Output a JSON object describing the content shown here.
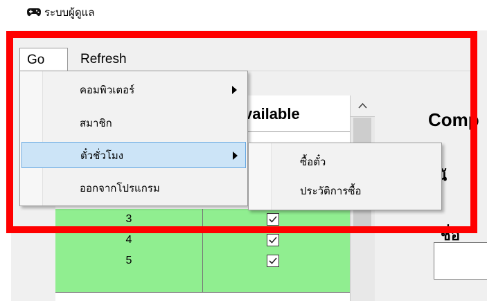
{
  "window": {
    "title": "ระบบผู้ดูแล",
    "icon": "gamepad-icon"
  },
  "menubar": {
    "items": [
      {
        "label": "Go"
      },
      {
        "label": "Refresh"
      }
    ]
  },
  "go_menu": {
    "items": [
      {
        "label": "คอมพิวเตอร์",
        "has_submenu": true
      },
      {
        "label": "สมาชิก",
        "has_submenu": false
      },
      {
        "label": "ตั๋วชั่วโมง",
        "has_submenu": true,
        "highlighted": true
      },
      {
        "label": "ออกจากโปรแกรม",
        "has_submenu": false
      }
    ]
  },
  "ticket_submenu": {
    "items": [
      {
        "label": "ซื้อตั๋ว"
      },
      {
        "label": "ประวัติการซื้อ"
      }
    ]
  },
  "grid": {
    "header_fragment": "vailable",
    "rows": [
      {
        "num": "3",
        "checked": true
      },
      {
        "num": "4",
        "checked": true
      },
      {
        "num": "5",
        "checked": true
      }
    ],
    "row_color": "#90ee90"
  },
  "right_panel": {
    "title_fragment": "Co",
    "title_fragment2": "mp",
    "label1_fragment": "นั",
    "label2_fragment": "ชื่อ"
  },
  "colors": {
    "highlight_frame": "#ff0000",
    "menu_highlight": "#cce4f7"
  }
}
